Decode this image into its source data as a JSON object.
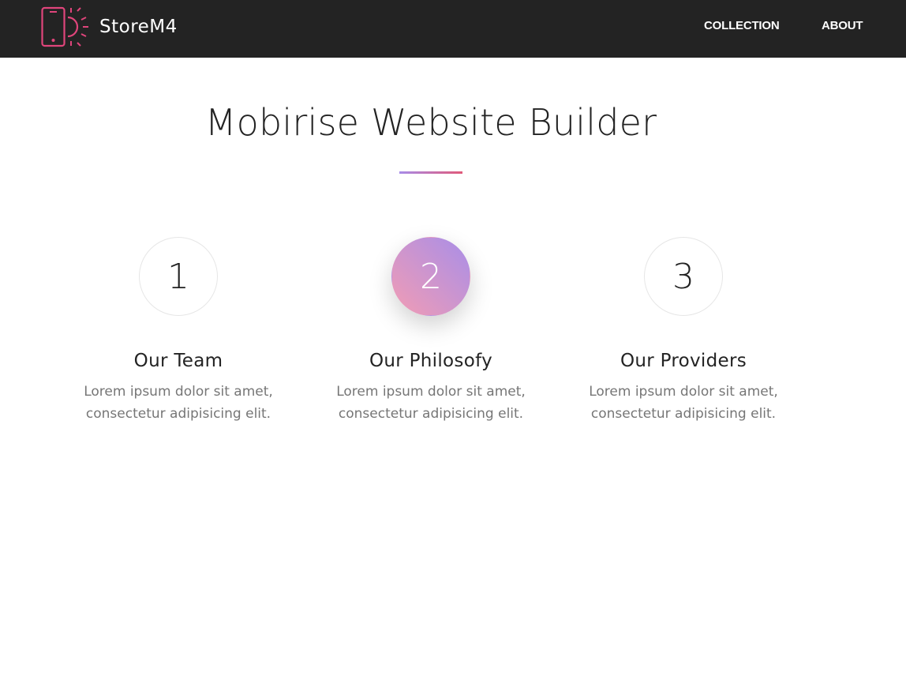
{
  "navbar": {
    "brand_name": "StoreM4",
    "logo_icon": "phone-sun-icon",
    "links": [
      {
        "label": "COLLECTION"
      },
      {
        "label": "ABOUT"
      }
    ]
  },
  "hero": {
    "title": "Mobirise Website Builder"
  },
  "features": [
    {
      "number": "1",
      "title": "Our Team",
      "text": "Lorem ipsum dolor sit amet, consectetur adipisicing elit."
    },
    {
      "number": "2",
      "title": "Our Philosofy",
      "text": "Lorem ipsum dolor sit amet, consectetur adipisicing elit."
    },
    {
      "number": "3",
      "title": "Our Providers",
      "text": "Lorem ipsum dolor sit amet, consectetur adipisicing elit."
    }
  ],
  "colors": {
    "navbar_bg": "#232323",
    "brand_accent": "#e0457b",
    "gradient_start": "#a88ee8",
    "gradient_end": "#f29cb4"
  }
}
